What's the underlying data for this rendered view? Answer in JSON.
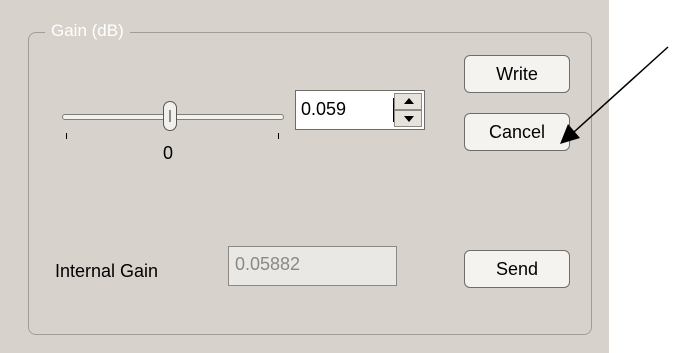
{
  "gain_group": {
    "label": "Gain (dB)",
    "slider": {
      "tick_label": "0"
    },
    "spin_value": "0.059",
    "buttons": {
      "write": "Write",
      "cancel": "Cancel",
      "send": "Send"
    },
    "internal_gain": {
      "label": "Internal Gain",
      "value": "0.05882"
    }
  }
}
